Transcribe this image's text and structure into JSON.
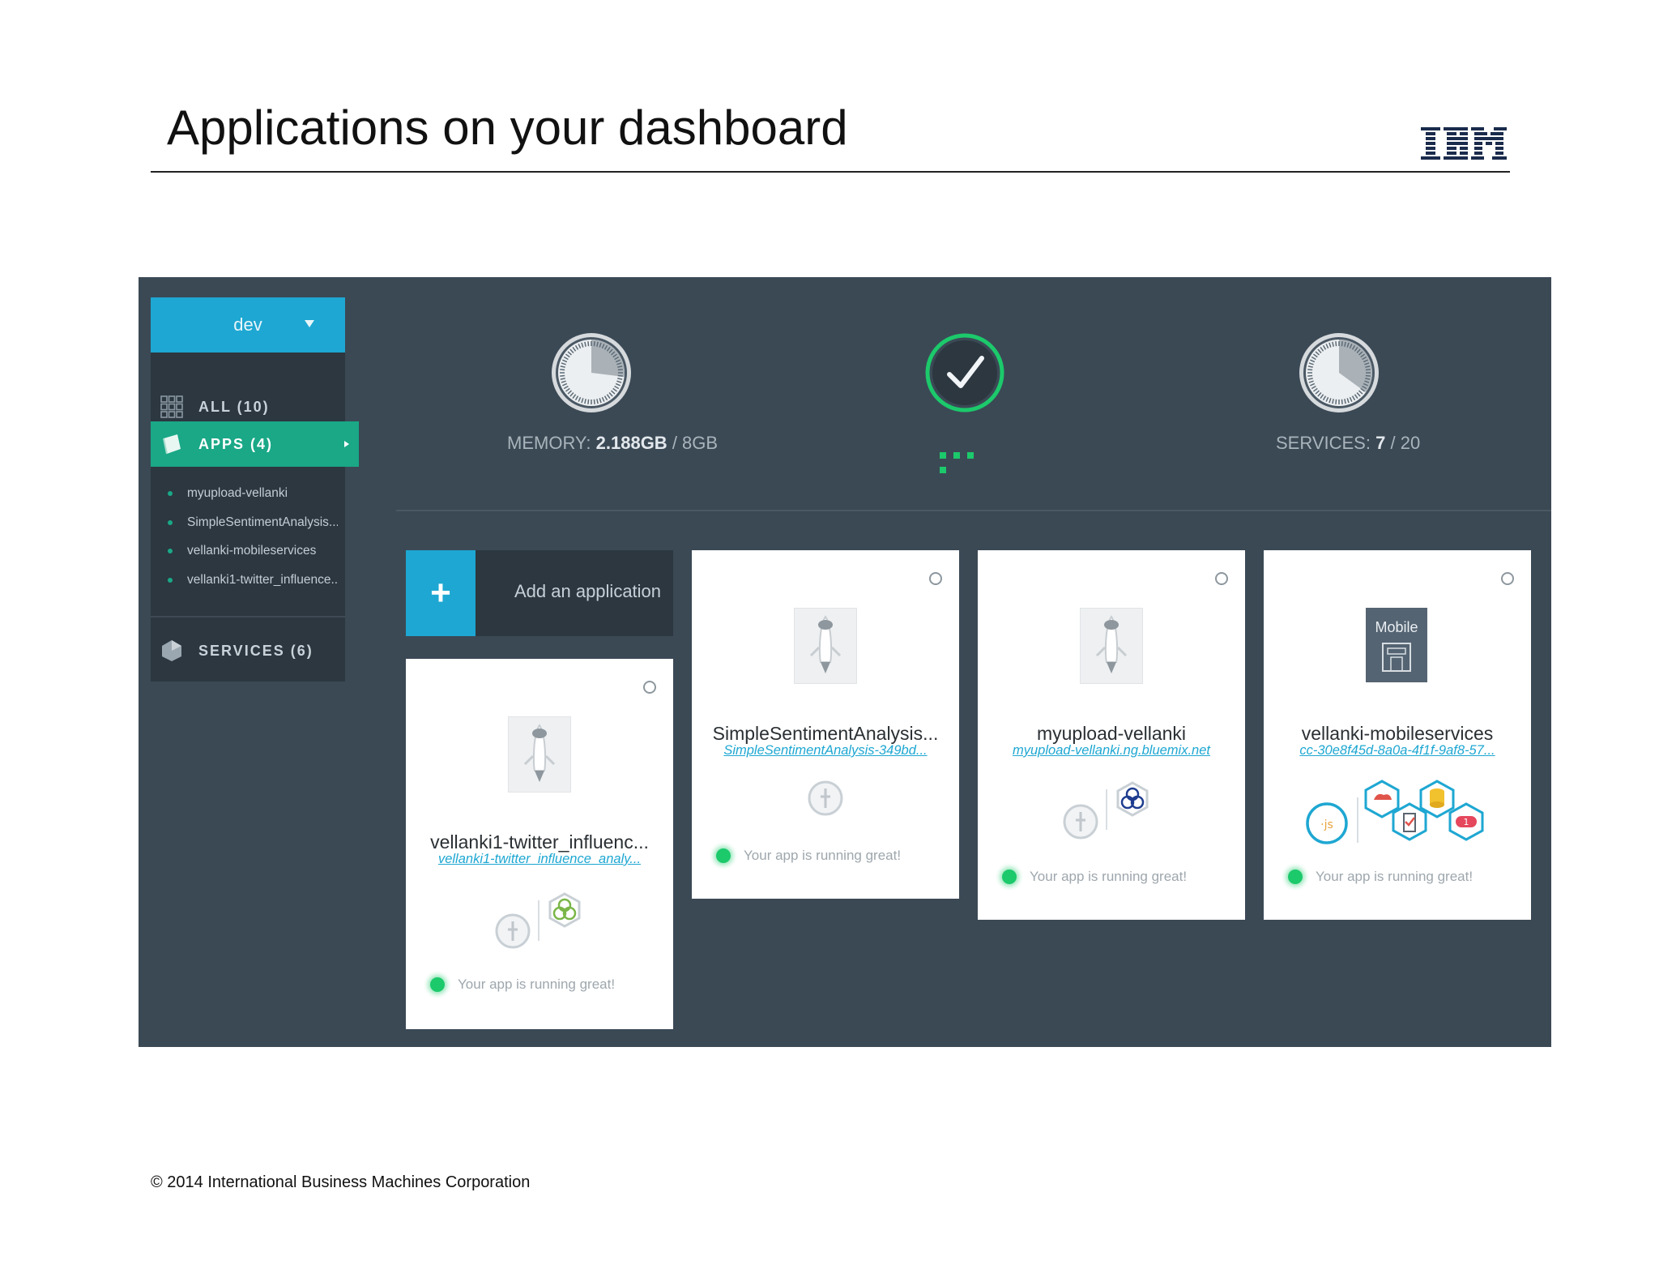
{
  "slide": {
    "title": "Applications on your dashboard",
    "footer": "© 2014 International Business Machines Corporation",
    "logo_text": "IBM"
  },
  "sidebar": {
    "org": "dev",
    "nav": [
      {
        "label": "ALL (10)",
        "icon": "grid-icon"
      },
      {
        "label": "APPS (4)",
        "icon": "apps-icon",
        "active": true
      },
      {
        "label": "SERVICES (6)",
        "icon": "services-icon"
      }
    ],
    "apps": [
      "myupload-vellanki",
      "SimpleSentimentAnalysis...",
      "vellanki-mobileservices",
      "vellanki1-twitter_influence..."
    ]
  },
  "gauges": {
    "memory": {
      "label": "MEMORY:",
      "used": "2.188GB",
      "total": "/ 8GB",
      "fraction": 0.27
    },
    "health": {
      "status": "running",
      "icon": "checkmark-icon"
    },
    "services": {
      "label": "SERVICES:",
      "used": "7",
      "total": "/ 20",
      "fraction": 0.35
    }
  },
  "add_app": {
    "label": "Add an application",
    "icon": "plus-icon"
  },
  "apps": [
    {
      "name": "vellanki1-twitter_influenc...",
      "url": "vellanki1-twitter_influence_analy...",
      "status": "Your app is running great!"
    },
    {
      "name": "SimpleSentimentAnalysis...",
      "url": "SimpleSentimentAnalysis-349bd...",
      "status": "Your app is running great!"
    },
    {
      "name": "myupload-vellanki",
      "url": "myupload-vellanki.ng.bluemix.net",
      "status": "Your app is running great!"
    },
    {
      "name": "vellanki-mobileservices",
      "url": "cc-30e8f45d-8a0a-4f1f-9af8-57...",
      "status": "Your app is running great!",
      "tile_label": "Mobile"
    }
  ],
  "colors": {
    "panel": "#3b4955",
    "accent_blue": "#1ea7d2",
    "accent_green": "#1aa887",
    "status_green": "#1cc96b"
  }
}
